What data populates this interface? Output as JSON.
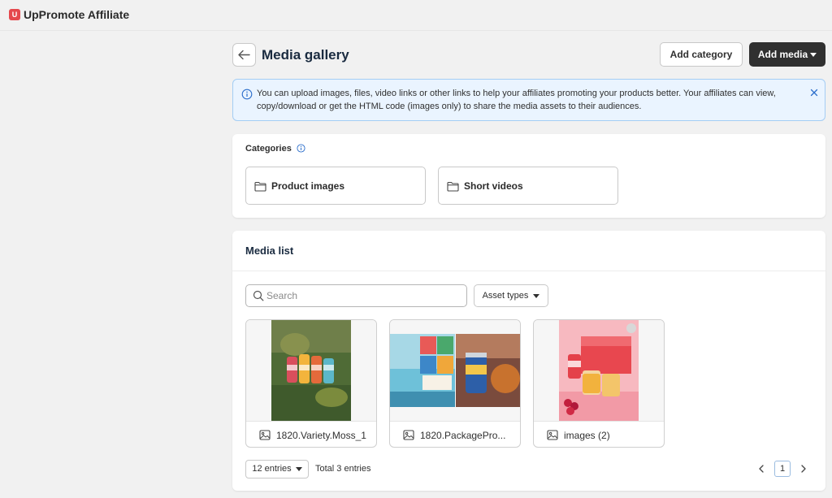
{
  "app": {
    "name": "UpPromote Affiliate",
    "logo_letter": "U"
  },
  "header": {
    "title": "Media gallery",
    "add_category_label": "Add category",
    "add_media_label": "Add media"
  },
  "banner": {
    "text": "You can upload images, files, video links or other links to help your affiliates promoting your products better. Your affiliates can view, copy/download or get the HTML code (images only) to share the media assets to their audiences."
  },
  "categories": {
    "heading": "Categories",
    "items": [
      {
        "label": "Product images"
      },
      {
        "label": "Short videos"
      }
    ]
  },
  "media": {
    "heading": "Media list",
    "search_placeholder": "Search",
    "asset_types_label": "Asset types",
    "items": [
      {
        "label": "1820.Variety.Moss_1"
      },
      {
        "label": "1820.PackagePro..."
      },
      {
        "label": "images (2)"
      }
    ]
  },
  "pagination": {
    "entries_label": "12 entries",
    "total_label": "Total 3 entries",
    "current_page": "1"
  },
  "colors": {
    "primary_button": "#303030",
    "info_banner_bg": "#eaf4ff",
    "logo": "#e5484d"
  }
}
